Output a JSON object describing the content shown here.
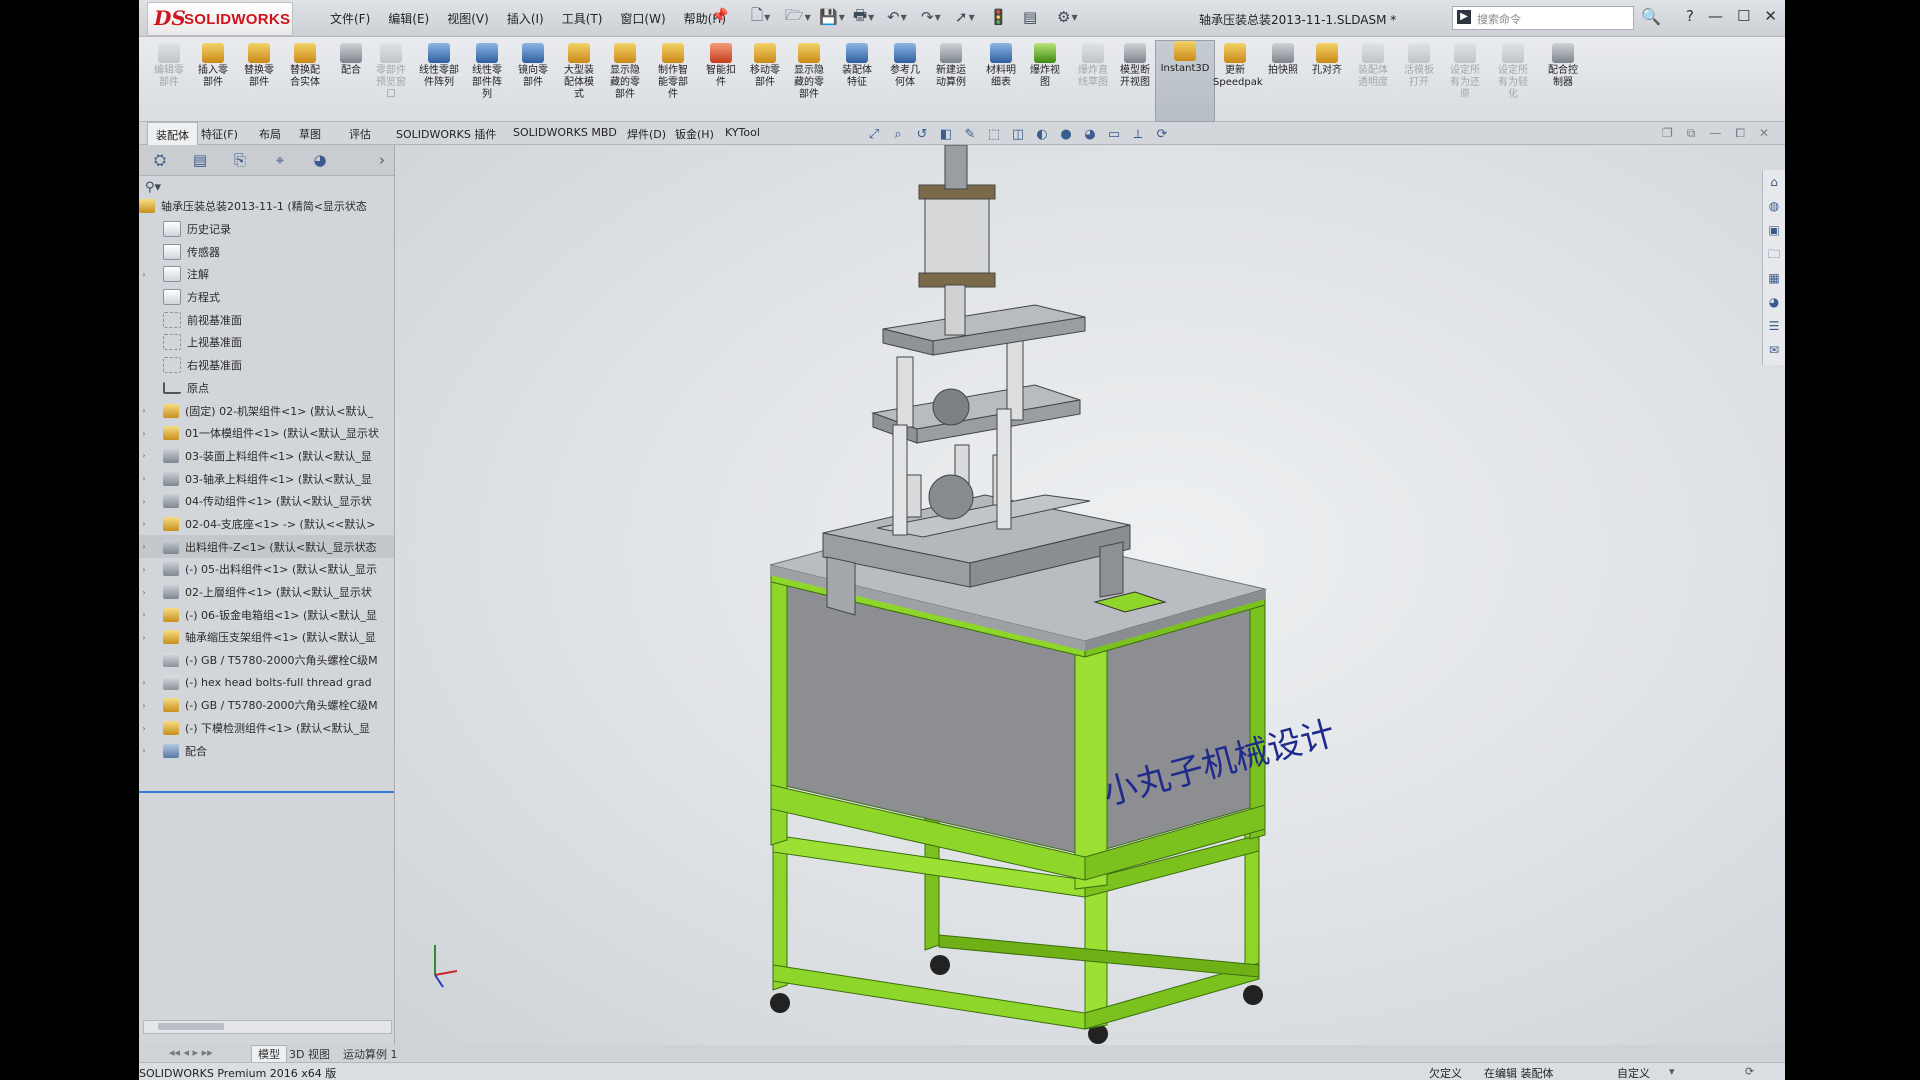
{
  "app": {
    "brand": "SOLIDWORKS",
    "file_title": "轴承压装总装2013-11-1.SLDASM *",
    "menu": [
      "文件(F)",
      "编辑(E)",
      "视图(V)",
      "插入(I)",
      "工具(T)",
      "窗口(W)",
      "帮助(H)"
    ],
    "search_placeholder": "搜索命令"
  },
  "command_manager": [
    {
      "label": "编辑零\n部件",
      "icon": "edit-component-icon",
      "disabled": true
    },
    {
      "label": "插入零\n部件",
      "icon": "insert-component-icon"
    },
    {
      "label": "替换零\n部件",
      "icon": "replace-component-icon"
    },
    {
      "label": "替换配\n合实体",
      "icon": "replace-mate-entities-icon"
    },
    {
      "label": "配合",
      "icon": "mate-icon"
    },
    {
      "label": "零部件\n预览窗\n口",
      "icon": "preview-window-icon",
      "disabled": true
    },
    {
      "label": "线性零部\n件阵列",
      "icon": "linear-pattern-icon"
    },
    {
      "label": "线性零\n部件阵\n列",
      "icon": "linear-pattern-2-icon"
    },
    {
      "label": "镜向零\n部件",
      "icon": "mirror-component-icon"
    },
    {
      "label": "大型装\n配体模\n式",
      "icon": "large-assembly-icon"
    },
    {
      "label": "显示隐\n藏的零\n部件",
      "icon": "show-hidden-icon"
    },
    {
      "label": "制作智\n能零部\n件",
      "icon": "smart-component-icon"
    },
    {
      "label": "智能扣\n件",
      "icon": "smart-fasteners-icon"
    },
    {
      "label": "移动零\n部件",
      "icon": "move-component-icon"
    },
    {
      "label": "显示隐\n藏的零\n部件",
      "icon": "show-hidden-2-icon"
    },
    {
      "label": "装配体\n特征",
      "icon": "assembly-features-icon"
    },
    {
      "label": "参考几\n何体",
      "icon": "reference-geometry-icon"
    },
    {
      "label": "新建运\n动算例",
      "icon": "new-motion-study-icon"
    },
    {
      "label": "材料明\n细表",
      "icon": "bom-icon"
    },
    {
      "label": "爆炸视\n图",
      "icon": "exploded-view-icon"
    },
    {
      "label": "爆炸直\n线草图",
      "icon": "explode-line-sketch-icon",
      "disabled": true
    },
    {
      "label": "模型断\n开视图",
      "icon": "broken-out-view-icon"
    },
    {
      "label": "Instant3D",
      "icon": "instant3d-icon",
      "active": true
    },
    {
      "label": "更新\nSpeedpak",
      "icon": "speedpak-icon"
    },
    {
      "label": "拍快照",
      "icon": "snapshot-icon"
    },
    {
      "label": "孔对齐",
      "icon": "hole-alignment-icon"
    },
    {
      "label": "装配体\n透明度",
      "icon": "transparency-icon",
      "disabled": true
    },
    {
      "label": "活模板\n打开",
      "icon": "template-open-icon",
      "disabled": true
    },
    {
      "label": "设定所\n有为还\n原",
      "icon": "set-all-resolved-icon",
      "disabled": true
    },
    {
      "label": "设定所\n有为轻\n化",
      "icon": "set-all-lightweight-icon",
      "disabled": true
    },
    {
      "label": "配合控\n制器",
      "icon": "mate-controller-icon"
    }
  ],
  "tabs": [
    "装配体",
    "特征(F)",
    "布局",
    "草图",
    "评估",
    "SOLIDWORKS 插件",
    "SOLIDWORKS MBD",
    "焊件(D)",
    "钣金(H)",
    "KYTool"
  ],
  "active_tab": "装配体",
  "feature_tree": [
    {
      "label": "轴承压装总装2013-11-1 (精简<显示状态",
      "icon": "assembly-icon",
      "root": true
    },
    {
      "label": "历史记录",
      "icon": "history-icon"
    },
    {
      "label": "传感器",
      "icon": "sensor-icon"
    },
    {
      "label": "注解",
      "icon": "annotation-icon",
      "expand": true
    },
    {
      "label": "方程式",
      "icon": "equation-icon"
    },
    {
      "label": "前视基准面",
      "icon": "plane-icon"
    },
    {
      "label": "上视基准面",
      "icon": "plane-icon"
    },
    {
      "label": "右视基准面",
      "icon": "plane-icon"
    },
    {
      "label": "原点",
      "icon": "origin-icon"
    },
    {
      "label": "(固定) 02-机架组件<1> (默认<默认_",
      "icon": "subassembly-icon",
      "expand": true
    },
    {
      "label": "01一体模组件<1> (默认<默认_显示状",
      "icon": "subassembly-icon",
      "expand": true
    },
    {
      "label": "03-装面上料组件<1> (默认<默认_显",
      "icon": "subassembly-gray-icon",
      "expand": true
    },
    {
      "label": "03-轴承上料组件<1> (默认<默认_显",
      "icon": "subassembly-gray-icon",
      "expand": true
    },
    {
      "label": "04-传动组件<1> (默认<默认_显示状",
      "icon": "flexible-subassembly-icon",
      "expand": true
    },
    {
      "label": "02-04-支底座<1> -> (默认<<默认>",
      "icon": "subassembly-icon",
      "expand": true
    },
    {
      "label": "出料组件-Z<1> (默认<默认_显示状态",
      "icon": "flexible-subassembly-icon",
      "expand": true,
      "highlight": true
    },
    {
      "label": "(-) 05-出料组件<1> (默认<默认_显示",
      "icon": "subassembly-gray-icon",
      "expand": true
    },
    {
      "label": "02-上層组件<1> (默认<默认_显示状",
      "icon": "flexible-subassembly-icon",
      "expand": true
    },
    {
      "label": "(-) 06-钣金电箱组<1> (默认<默认_显",
      "icon": "subassembly-icon",
      "expand": true
    },
    {
      "label": "轴承缩压支架组件<1> (默认<默认_显",
      "icon": "subassembly-icon",
      "expand": true
    },
    {
      "label": "(-) GB / T5780-2000六角头螺栓C级M",
      "icon": "bolt-icon"
    },
    {
      "label": "(-) hex head bolts-full thread grad",
      "icon": "bolt-icon",
      "expand": true
    },
    {
      "label": "(-) GB / T5780-2000六角头螺栓C级M",
      "icon": "subassembly-icon",
      "expand": true
    },
    {
      "label": "(-) 下模检测组件<1> (默认<默认_显",
      "icon": "subassembly-icon",
      "expand": true
    },
    {
      "label": "配合",
      "icon": "mates-icon",
      "expand": true
    }
  ],
  "bottom_tabs": [
    "模型",
    "3D 视图",
    "运动算例 1"
  ],
  "active_bottom_tab": "模型",
  "status": {
    "version": "SOLIDWORKS Premium 2016 x64 版",
    "defined": "欠定义",
    "editing": "在编辑 装配体",
    "units": "自定义"
  },
  "model": {
    "panel_text": "小丸子机械设计",
    "colors": {
      "frame": "#8fd62a",
      "frame_dark": "#5ea315",
      "panel": "#8c8e92",
      "top": "#b9bcc0",
      "text": "#1f2a8c"
    }
  }
}
